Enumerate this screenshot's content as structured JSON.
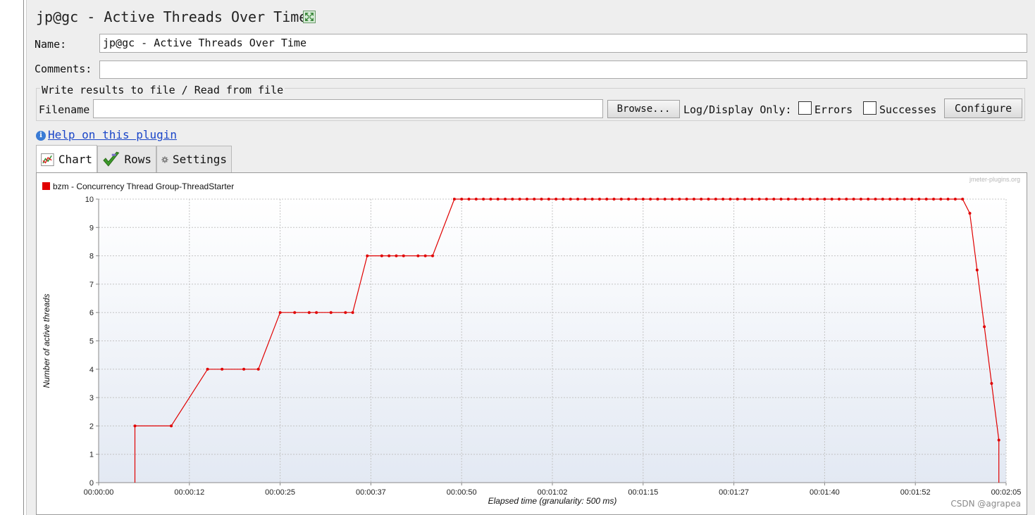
{
  "title": "jp@gc - Active Threads Over Time",
  "name_label": "Name:",
  "name_value": "jp@gc - Active Threads Over Time",
  "comments_label": "Comments:",
  "comments_value": "",
  "file_section": {
    "legend": "Write results to file / Read from file",
    "filename_label": "Filename",
    "filename_value": "",
    "browse_label": "Browse...",
    "log_display_label": "Log/Display Only:",
    "errors_label": "Errors",
    "errors_checked": false,
    "successes_label": "Successes",
    "successes_checked": false,
    "configure_label": "Configure"
  },
  "help_text": "Help on this plugin",
  "tabs": [
    {
      "label": "Chart",
      "icon": "line-chart-icon",
      "active": true
    },
    {
      "label": "Rows",
      "icon": "checkmark-icon",
      "active": false
    },
    {
      "label": "Settings",
      "icon": "gear-icon",
      "active": false
    }
  ],
  "colors": {
    "series": "#e00000",
    "link": "#1a46c8"
  },
  "watermark": "CSDN @agrapea",
  "chart_data": {
    "type": "line",
    "source_label": "jmeter-plugins.org",
    "xlabel": "Elapsed time (granularity: 500 ms)",
    "ylabel": "Number of active threads",
    "ylim": [
      0,
      10
    ],
    "xlim_seconds": [
      0,
      125
    ],
    "yticks": [
      "0",
      "1",
      "2",
      "3",
      "4",
      "5",
      "6",
      "7",
      "8",
      "9",
      "10"
    ],
    "xticks": [
      "00:00:00",
      "00:00:12",
      "00:00:25",
      "00:00:37",
      "00:00:50",
      "00:01:02",
      "00:01:15",
      "00:01:27",
      "00:01:40",
      "00:01:52",
      "00:02:05"
    ],
    "grid": true,
    "legend_position": "top-left",
    "series": [
      {
        "name": "bzm - Concurrency Thread Group-ThreadStarter",
        "points": [
          [
            5,
            0
          ],
          [
            5,
            2
          ],
          [
            10,
            2
          ],
          [
            15,
            4
          ],
          [
            17,
            4
          ],
          [
            20,
            4
          ],
          [
            22,
            4
          ],
          [
            25,
            6
          ],
          [
            27,
            6
          ],
          [
            29,
            6
          ],
          [
            30,
            6
          ],
          [
            32,
            6
          ],
          [
            34,
            6
          ],
          [
            35,
            6
          ],
          [
            37,
            8
          ],
          [
            39,
            8
          ],
          [
            40,
            8
          ],
          [
            41,
            8
          ],
          [
            42,
            8
          ],
          [
            44,
            8
          ],
          [
            45,
            8
          ],
          [
            46,
            8
          ],
          [
            49,
            10
          ],
          [
            50,
            10
          ],
          [
            51,
            10
          ],
          [
            52,
            10
          ],
          [
            53,
            10
          ],
          [
            54,
            10
          ],
          [
            55,
            10
          ],
          [
            56,
            10
          ],
          [
            57,
            10
          ],
          [
            58,
            10
          ],
          [
            59,
            10
          ],
          [
            60,
            10
          ],
          [
            61,
            10
          ],
          [
            62,
            10
          ],
          [
            63,
            10
          ],
          [
            64,
            10
          ],
          [
            65,
            10
          ],
          [
            66,
            10
          ],
          [
            67,
            10
          ],
          [
            68,
            10
          ],
          [
            69,
            10
          ],
          [
            70,
            10
          ],
          [
            71,
            10
          ],
          [
            72,
            10
          ],
          [
            73,
            10
          ],
          [
            74,
            10
          ],
          [
            75,
            10
          ],
          [
            76,
            10
          ],
          [
            77,
            10
          ],
          [
            78,
            10
          ],
          [
            79,
            10
          ],
          [
            80,
            10
          ],
          [
            81,
            10
          ],
          [
            82,
            10
          ],
          [
            83,
            10
          ],
          [
            84,
            10
          ],
          [
            85,
            10
          ],
          [
            86,
            10
          ],
          [
            87,
            10
          ],
          [
            88,
            10
          ],
          [
            89,
            10
          ],
          [
            90,
            10
          ],
          [
            91,
            10
          ],
          [
            92,
            10
          ],
          [
            93,
            10
          ],
          [
            94,
            10
          ],
          [
            95,
            10
          ],
          [
            96,
            10
          ],
          [
            97,
            10
          ],
          [
            98,
            10
          ],
          [
            99,
            10
          ],
          [
            100,
            10
          ],
          [
            101,
            10
          ],
          [
            102,
            10
          ],
          [
            103,
            10
          ],
          [
            104,
            10
          ],
          [
            105,
            10
          ],
          [
            106,
            10
          ],
          [
            107,
            10
          ],
          [
            108,
            10
          ],
          [
            109,
            10
          ],
          [
            110,
            10
          ],
          [
            111,
            10
          ],
          [
            112,
            10
          ],
          [
            113,
            10
          ],
          [
            114,
            10
          ],
          [
            115,
            10
          ],
          [
            116,
            10
          ],
          [
            117,
            10
          ],
          [
            118,
            10
          ],
          [
            119,
            10
          ],
          [
            120,
            9.5
          ],
          [
            121,
            7.5
          ],
          [
            122,
            5.5
          ],
          [
            123,
            3.5
          ],
          [
            124,
            1.5
          ],
          [
            124,
            0
          ]
        ]
      }
    ]
  }
}
